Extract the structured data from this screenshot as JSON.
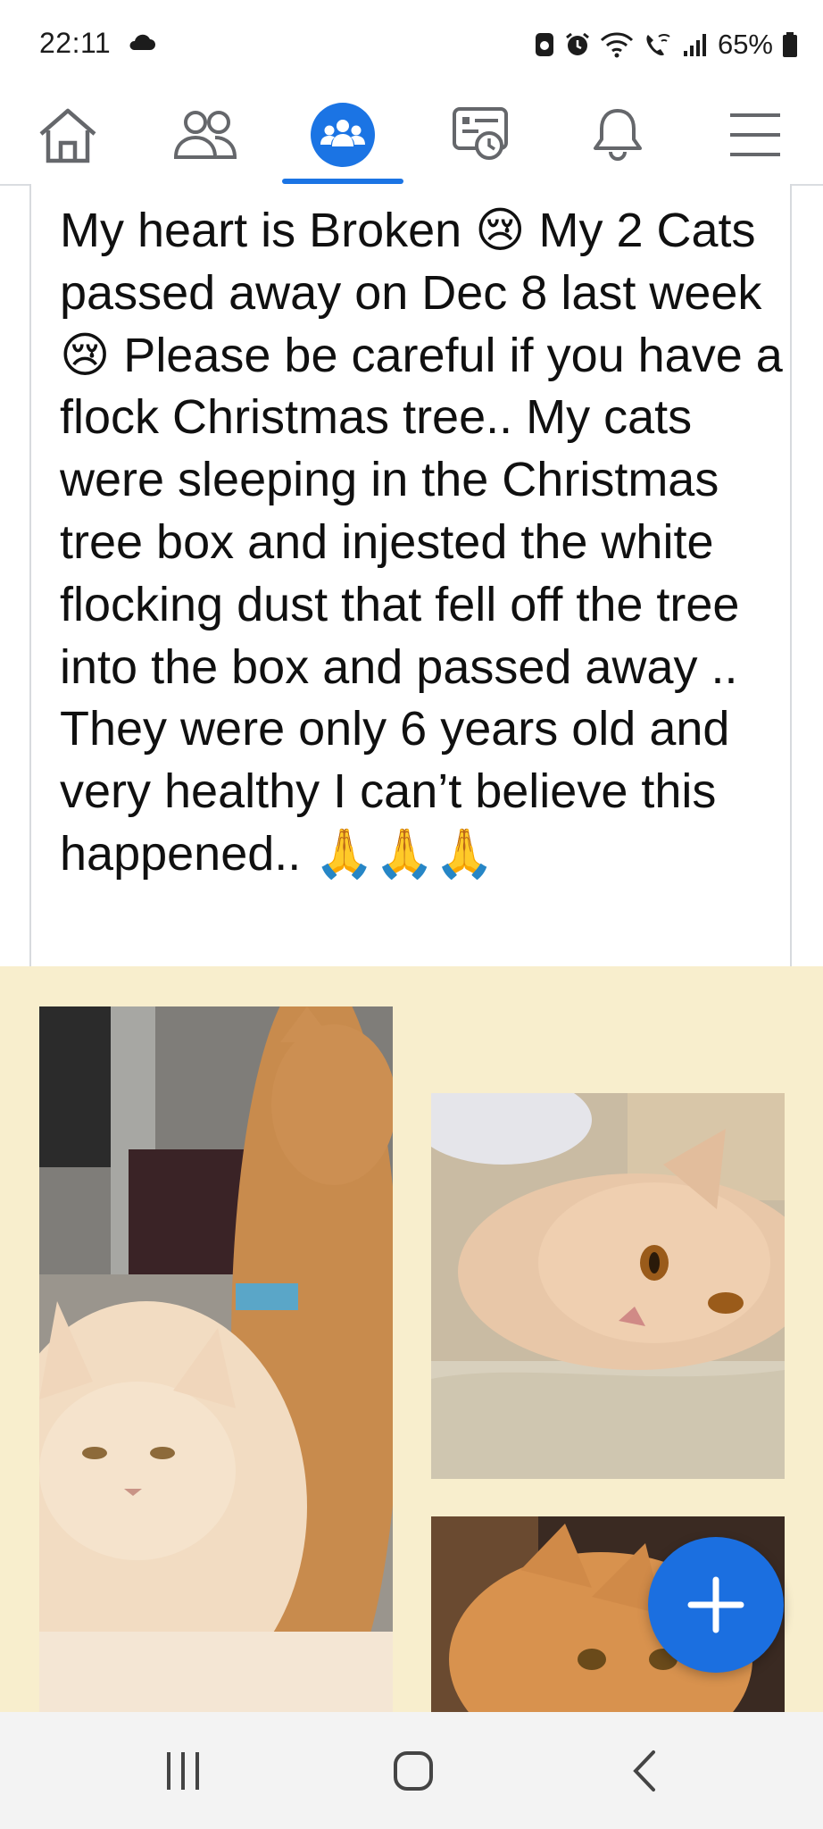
{
  "status_bar": {
    "time": "22:11",
    "battery_percent": "65%"
  },
  "top_nav": {
    "active_tab": "groups",
    "accent_color": "#1b74e4",
    "tabs": [
      {
        "id": "home",
        "icon": "home-icon"
      },
      {
        "id": "friends",
        "icon": "friends-icon"
      },
      {
        "id": "groups",
        "icon": "groups-icon"
      },
      {
        "id": "watch",
        "icon": "news-feed-clock-icon"
      },
      {
        "id": "notifications",
        "icon": "bell-icon"
      },
      {
        "id": "menu",
        "icon": "hamburger-menu-icon"
      }
    ]
  },
  "post": {
    "text": "My heart is Broken 😢 My 2 Cats passed away on Dec 8 last week 😢 Please be careful if you have a flock Christmas tree.. My cats were sleeping in the Christmas tree box and injested the white flocking dust that fell off the tree into the box and passed away .. They were only 6 years old and very healthy I can’t believe this happened.. 🙏🙏🙏",
    "background_color": "#f8eecd"
  },
  "photos": [
    {
      "id": "photo-1",
      "description_icon": "cats-photo-icon"
    },
    {
      "id": "photo-2",
      "description_icon": "cat-lying-photo-icon"
    },
    {
      "id": "photo-3",
      "description_icon": "cat-face-photo-icon"
    }
  ],
  "fab": {
    "icon": "plus-icon",
    "color": "#1b6fe0"
  },
  "system_nav": [
    {
      "id": "recents",
      "icon": "recents-icon"
    },
    {
      "id": "home",
      "icon": "home-circle-icon"
    },
    {
      "id": "back",
      "icon": "back-chevron-icon"
    }
  ]
}
